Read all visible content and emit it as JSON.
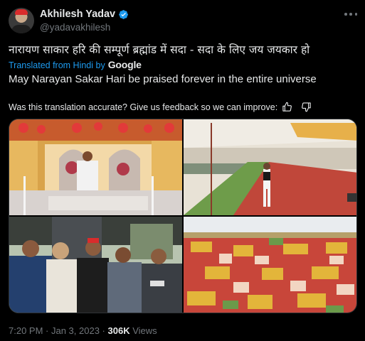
{
  "author": {
    "display_name": "Akhilesh Yadav",
    "handle": "@yadavakhilesh",
    "verified": true
  },
  "tweet": {
    "text_hindi": "नारायण साकार हरि की सम्पूर्ण ब्रह्मांड में सदा - सदा के लिए जय जयकार हो",
    "translated_label": "Translated from Hindi by",
    "translator_brand": "Google",
    "translation": "May Narayan Sakar Hari be praised forever in the entire universe",
    "feedback_prompt": "Was this translation accurate? Give us feedback so we can improve:"
  },
  "media": {
    "photo_count": 4,
    "photos": [
      {
        "description_name": "photo-seated-on-stage"
      },
      {
        "description_name": "photo-standing-on-carpet"
      },
      {
        "description_name": "photo-seated-audience-front"
      },
      {
        "description_name": "photo-large-crowd"
      }
    ]
  },
  "meta": {
    "time": "7:20 PM",
    "sep1": " · ",
    "date": "Jan 3, 2023",
    "sep2": " · ",
    "views_count": "306K",
    "views_label": " Views"
  },
  "colors": {
    "background": "#000000",
    "text_primary": "#e7e9ea",
    "text_secondary": "#71767b",
    "accent_blue": "#1d9bf0"
  },
  "icons": {
    "verified": "verified-badge-icon",
    "more": "more-options-icon",
    "thumbs_up": "thumbs-up-icon",
    "thumbs_down": "thumbs-down-icon"
  }
}
